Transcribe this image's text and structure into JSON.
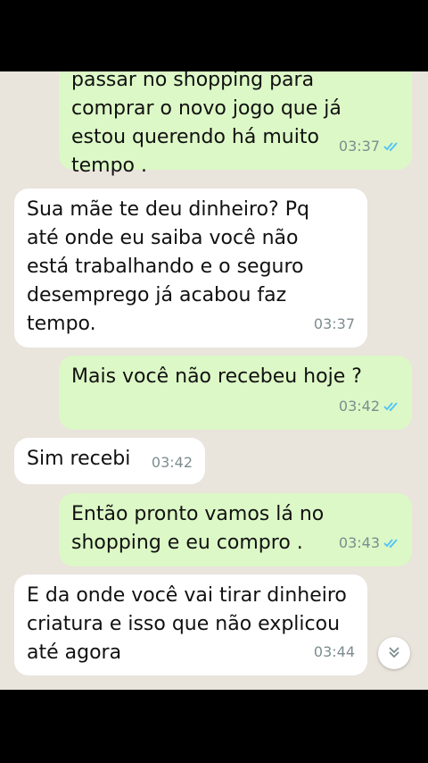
{
  "colors": {
    "outgoing_bubble": "#dcf8c6",
    "incoming_bubble": "#ffffff",
    "chat_background": "#e9e4dc",
    "read_ticks": "#4fc3f7",
    "timestamp": "#7d8c8e"
  },
  "messages": [
    {
      "direction": "out",
      "text": "passar no shopping para\ncomprar o novo jogo que já\nestou querendo há muito\ntempo .",
      "time": "03:37",
      "status": "read"
    },
    {
      "direction": "in",
      "text": "Sua mãe te deu dinheiro? Pq\naté onde eu saiba você não\nestá trabalhando e o seguro\ndesemprego já acabou faz\ntempo.",
      "time": "03:37"
    },
    {
      "direction": "out",
      "text": "Mais você não recebeu hoje ?",
      "time": "03:42",
      "status": "read"
    },
    {
      "direction": "in",
      "text": "Sim recebi",
      "time": "03:42"
    },
    {
      "direction": "out",
      "text": "Então pronto vamos lá no\nshopping e eu compro .",
      "time": "03:43",
      "status": "read"
    },
    {
      "direction": "in",
      "text": "E da onde você vai tirar dinheiro\ncriatura e isso que não explicou\naté agora",
      "time": "03:44"
    }
  ],
  "scroll_button_icon": "double-chevron-down-icon"
}
